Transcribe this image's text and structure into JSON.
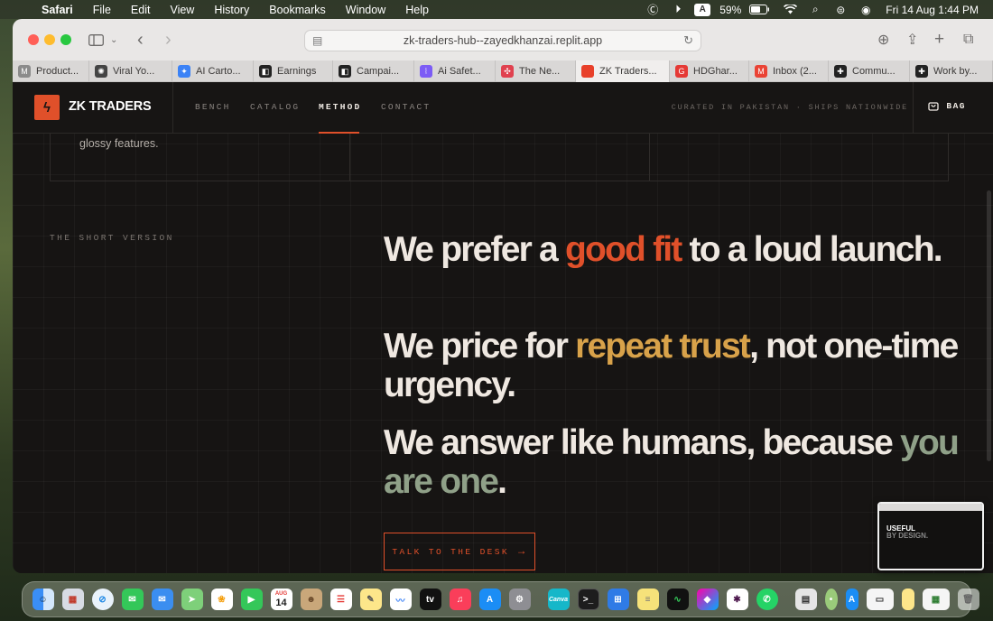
{
  "menubar": {
    "app": "Safari",
    "items": [
      "File",
      "Edit",
      "View",
      "History",
      "Bookmarks",
      "Window",
      "Help"
    ],
    "battery": "59%",
    "datetime": "Fri 14 Aug  1:44 PM",
    "input_source": "A"
  },
  "browser": {
    "url": "zk-traders-hub--zayedkhanzai.replit.app",
    "tabs": [
      {
        "label": "Product...",
        "icon": "M",
        "color": "#8b8b8b"
      },
      {
        "label": "Viral Yo...",
        "icon": "✺",
        "color": "#444444"
      },
      {
        "label": "AI Carto...",
        "icon": "✦",
        "color": "#3b82f6"
      },
      {
        "label": "Earnings",
        "icon": "◧",
        "color": "#222222"
      },
      {
        "label": "Campai...",
        "icon": "◧",
        "color": "#222222"
      },
      {
        "label": "Ai Safet...",
        "icon": "⦚",
        "color": "#7c5cf5"
      },
      {
        "label": "The Ne...",
        "icon": "✣",
        "color": "#e0414f"
      },
      {
        "label": "ZK Traders...",
        "icon": "",
        "color": "#e8402a"
      },
      {
        "label": "HDGhar...",
        "icon": "G",
        "color": "#e53935"
      },
      {
        "label": "Inbox (2...",
        "icon": "M",
        "color": "#ea4335"
      },
      {
        "label": "Commu...",
        "icon": "✚",
        "color": "#222222"
      },
      {
        "label": "Work by...",
        "icon": "✚",
        "color": "#222222"
      }
    ]
  },
  "site": {
    "brand": "ZK TRADERS",
    "nav": [
      "BENCH",
      "CATALOG",
      "METHOD",
      "CONTACT"
    ],
    "active_nav": "METHOD",
    "tagline": "CURATED IN PAKISTAN · SHIPS NATIONWIDE",
    "bag_label": "BAG",
    "card_text": "glossy features.",
    "section_label": "THE SHORT VERSION",
    "line1": {
      "a": "We prefer a ",
      "b": "good fit",
      "c": " to a loud launch."
    },
    "line2": {
      "a": "We price for ",
      "b": "repeat trust",
      "c": ", not one-time urgency."
    },
    "line3": {
      "a": "We answer like humans, because ",
      "b": "you are one",
      "c": "."
    },
    "cta": "TALK TO THE DESK",
    "thumb_line1": "USEFUL",
    "thumb_line2": "BY DESIGN."
  },
  "colors": {
    "accent": "#e0502a",
    "gold": "#d8a24a",
    "sage": "#8fa088"
  },
  "dock": {
    "calendar_month": "AUG",
    "calendar_day": "14",
    "canva": "Canva"
  }
}
